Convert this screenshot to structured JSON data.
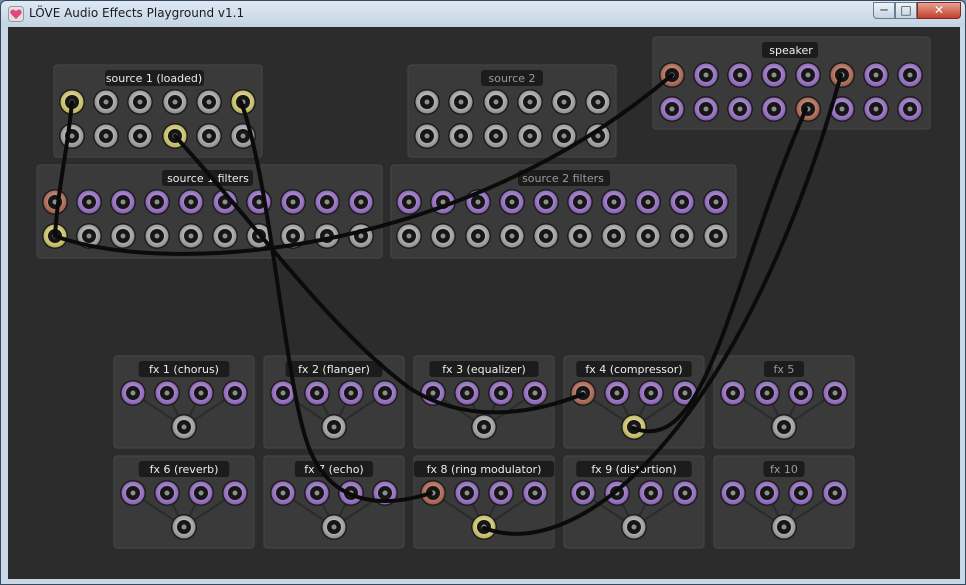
{
  "window": {
    "title": "LÖVE Audio Effects Playground v1.1",
    "buttons": {
      "minimize": "─",
      "maximize": "□",
      "close": "✕"
    }
  },
  "panels": {
    "source1": {
      "label": "source 1 (loaded)"
    },
    "source2": {
      "label": "source 2"
    },
    "speaker": {
      "label": "speaker"
    },
    "source1_filters": {
      "label": "source 1 filters"
    },
    "source2_filters": {
      "label": "source 2 filters"
    },
    "fx": [
      {
        "label": "fx 1 (chorus)"
      },
      {
        "label": "fx 2 (flanger)"
      },
      {
        "label": "fx 3 (equalizer)"
      },
      {
        "label": "fx 4 (compressor)"
      },
      {
        "label": "fx 5"
      },
      {
        "label": "fx 6 (reverb)"
      },
      {
        "label": "fx 7 (echo)"
      },
      {
        "label": "fx 8 (ring modulator)"
      },
      {
        "label": "fx 9 (distortion)"
      },
      {
        "label": "fx 10"
      }
    ]
  },
  "colors": {
    "background": "#2c2c2c",
    "panel": "#3a3a3a",
    "jack_purple": "#a682cf",
    "jack_gray": "#bdbdbd",
    "jack_yellow_plug": "#e5df8e",
    "jack_pink_plug": "#c7826d",
    "cable": "#0b0b0b"
  },
  "icons": {
    "app": "heart-icon"
  }
}
